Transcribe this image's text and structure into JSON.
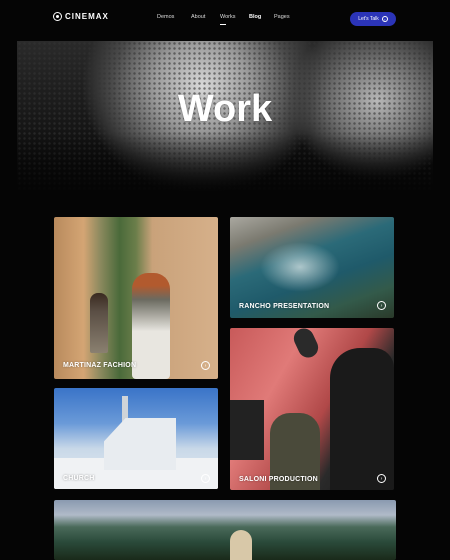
{
  "nav": {
    "logo_text": "CINEMAX",
    "items": [
      {
        "label": "Demos"
      },
      {
        "label": "About"
      },
      {
        "label": "Works"
      },
      {
        "label": "Blog"
      },
      {
        "label": "Pages"
      }
    ],
    "active_item": "Works",
    "cta_label": "Let's Talk",
    "cta_color": "#2b34b8"
  },
  "hero": {
    "title": "Work"
  },
  "projects": [
    {
      "title": "MARTINAZ FACHION",
      "icon": "arrow-circle-icon"
    },
    {
      "title": "RANCHO PRESENTATION",
      "icon": "arrow-circle-icon"
    },
    {
      "title": "SALONI PRODUCTION",
      "icon": "arrow-circle-icon"
    },
    {
      "title": "CHURCH",
      "icon": "arrow-circle-icon"
    },
    {
      "title": "",
      "icon": ""
    }
  ]
}
